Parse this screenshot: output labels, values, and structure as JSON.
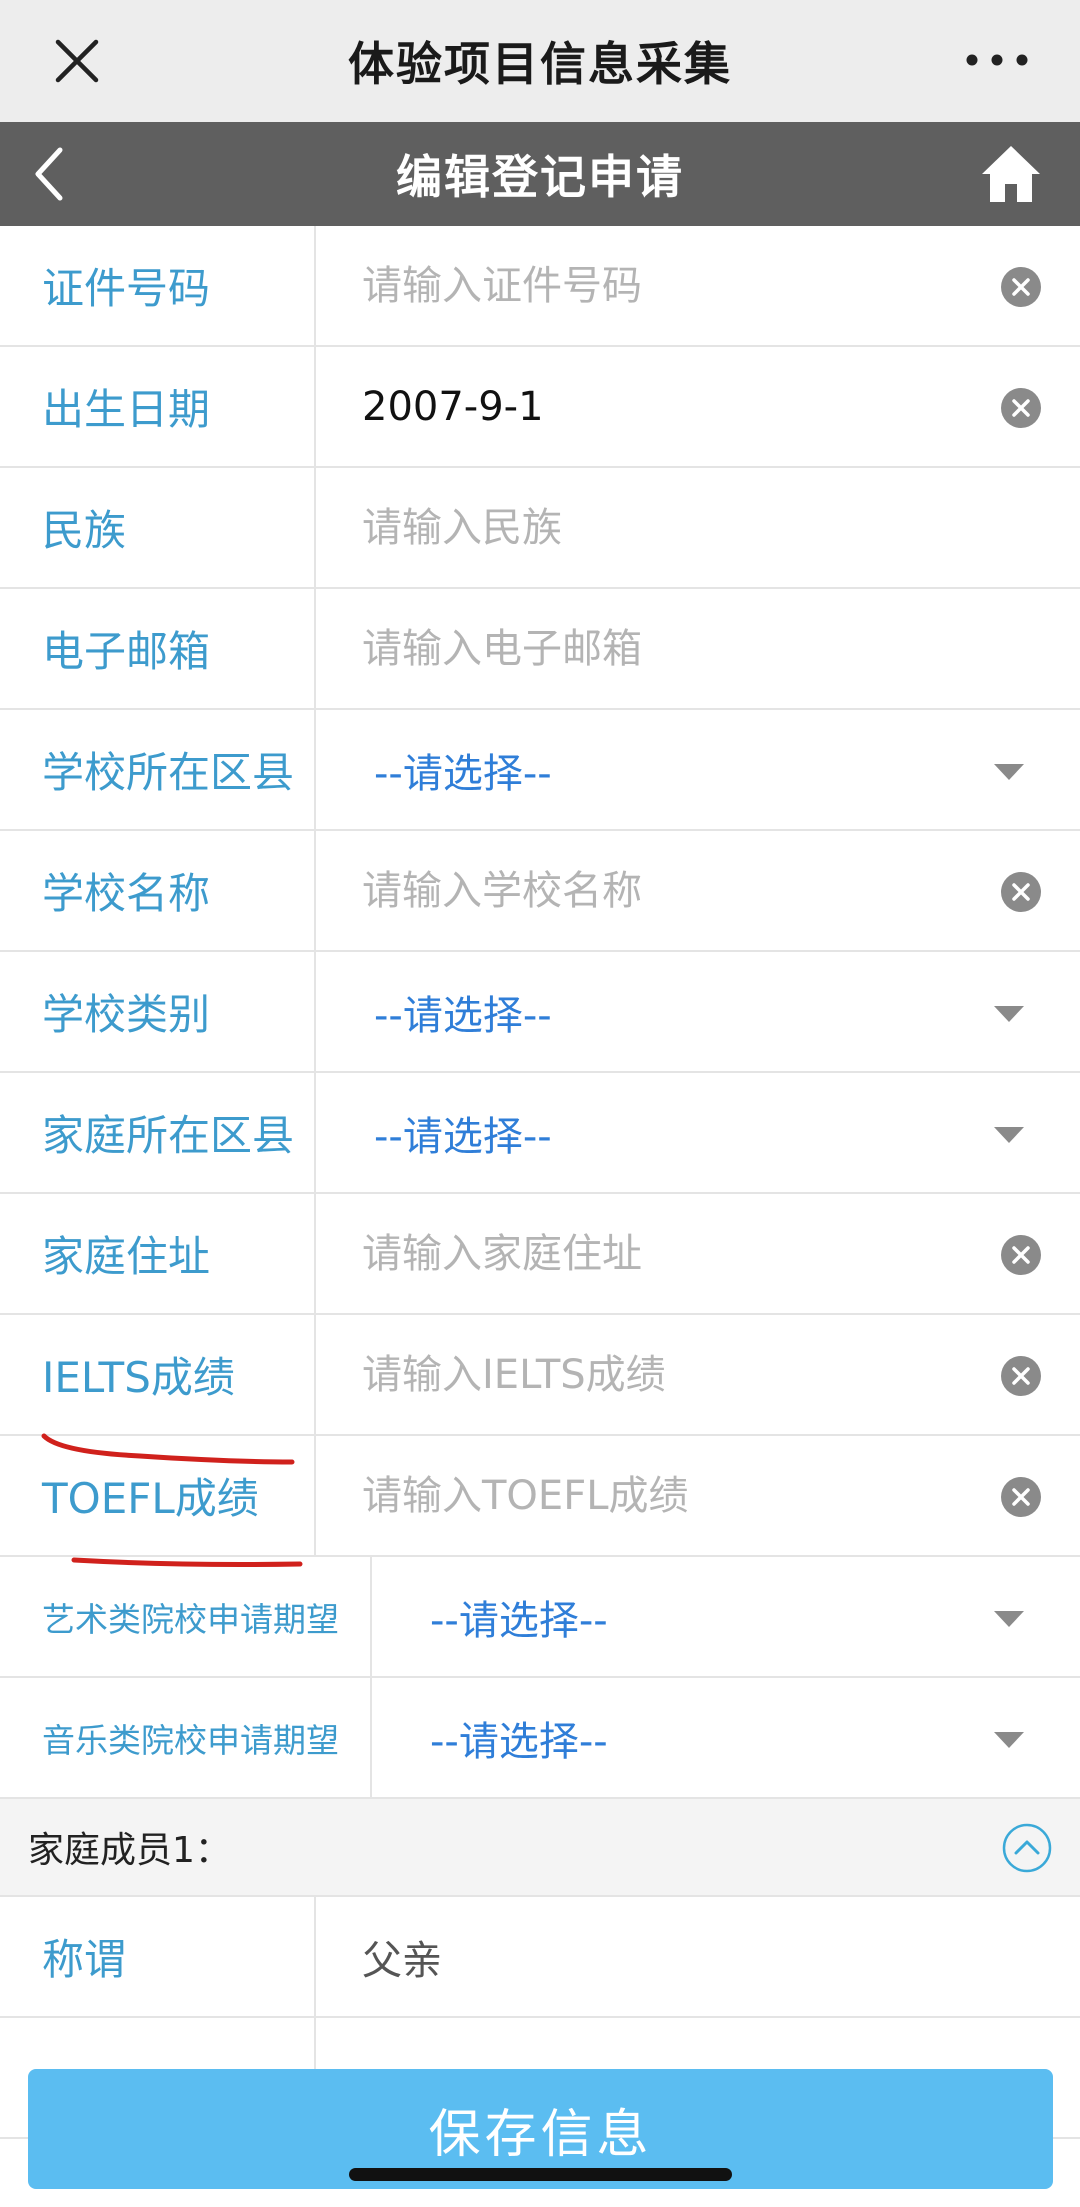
{
  "window": {
    "title": "体验项目信息采集",
    "close_icon": "close-icon",
    "more_icon": "more-dots-icon"
  },
  "navbar": {
    "title": "编辑登记申请",
    "back_icon": "back-chevron-icon",
    "home_icon": "home-icon"
  },
  "fields": [
    {
      "label": "证件号码",
      "type": "text",
      "value": "",
      "placeholder": "请输入证件号码",
      "clearable": true
    },
    {
      "label": "出生日期",
      "type": "text",
      "value": "2007-9-1",
      "placeholder": "",
      "clearable": true
    },
    {
      "label": "民族",
      "type": "text",
      "value": "",
      "placeholder": "请输入民族",
      "clearable": false
    },
    {
      "label": "电子邮箱",
      "type": "text",
      "value": "",
      "placeholder": "请输入电子邮箱",
      "clearable": false
    },
    {
      "label": "学校所在区县",
      "type": "select",
      "value": "--请选择--"
    },
    {
      "label": "学校名称",
      "type": "text",
      "value": "",
      "placeholder": "请输入学校名称",
      "clearable": true
    },
    {
      "label": "学校类别",
      "type": "select",
      "value": "--请选择--"
    },
    {
      "label": "家庭所在区县",
      "type": "select",
      "value": "--请选择--"
    },
    {
      "label": "家庭住址",
      "type": "text",
      "value": "",
      "placeholder": "请输入家庭住址",
      "clearable": true
    },
    {
      "label": "IELTS成绩",
      "type": "text",
      "value": "",
      "placeholder": "请输入IELTS成绩",
      "clearable": true
    },
    {
      "label": "TOEFL成绩",
      "type": "text",
      "value": "",
      "placeholder": "请输入TOEFL成绩",
      "clearable": true
    },
    {
      "label": "艺术类院校申请期望",
      "type": "select",
      "value": "--请选择--"
    },
    {
      "label": "音乐类院校申请期望",
      "type": "select",
      "value": "--请选择--"
    }
  ],
  "family_section": {
    "header": "家庭成员1：",
    "collapse_icon": "collapse-up-icon",
    "fields": [
      {
        "label": "称谓",
        "value": "父亲"
      }
    ]
  },
  "save_button": {
    "label": "保存信息"
  },
  "colors": {
    "label": "#3d9bcd",
    "select": "#2f7ed8",
    "navbar": "#5f5f5f",
    "button": "#5bbdf1",
    "annotation": "#d0211c"
  }
}
